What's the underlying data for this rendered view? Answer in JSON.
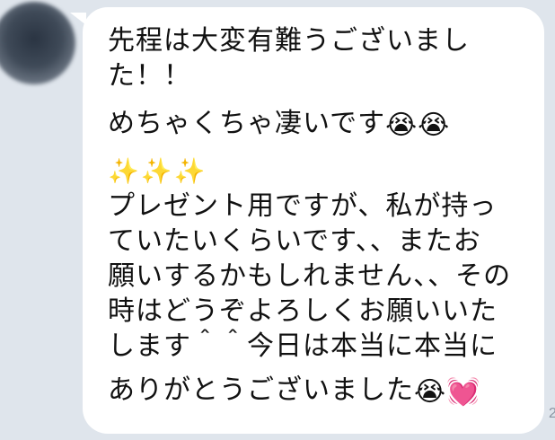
{
  "thread": {
    "background_color": "#dfe5ec",
    "bubble_color": "#ffffff"
  },
  "message": {
    "paragraph_1_line_1": "先程は大変有難うございまし",
    "paragraph_1_line_2": "た！！",
    "paragraph_2_text": "めちゃくちゃ凄いです",
    "paragraph_2_emoji_1": "😭",
    "paragraph_2_emoji_2": "😭",
    "sparkles": "✨✨✨",
    "paragraph_3_lines": [
      "プレゼント用ですが、私が持っ",
      "ていたいくらいです、、またお",
      "願いするかもしれません、、その",
      "時はどうぞよろしくお願いいた",
      "します＾＾今日は本当に本当に"
    ],
    "paragraph_4_text": "ありがとうございました",
    "paragraph_4_emoji_1": "😭",
    "paragraph_4_emoji_2": "💓"
  },
  "timestamp_fragment": "2"
}
